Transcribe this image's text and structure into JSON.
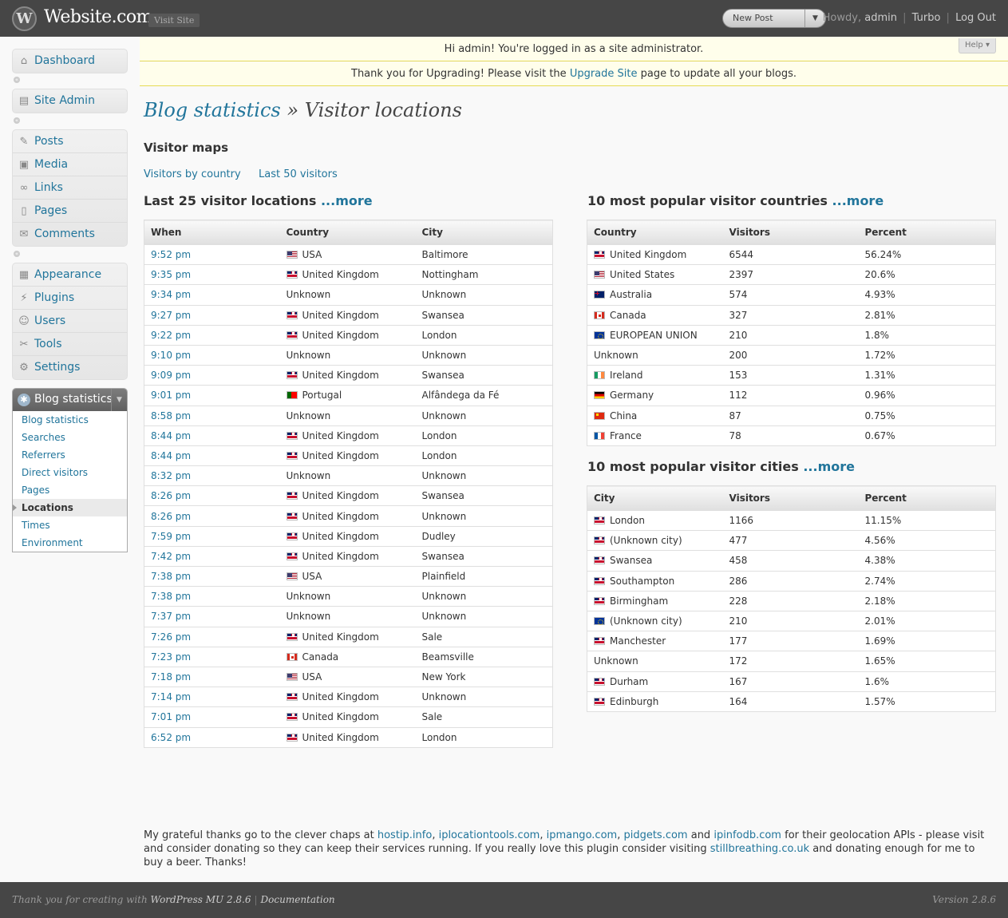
{
  "header": {
    "logo": "W",
    "site_title": "Website.com",
    "visit_site": "Visit Site",
    "new_post": "New Post",
    "howdy": "Howdy,",
    "user": "admin",
    "turbo": "Turbo",
    "logout": "Log Out"
  },
  "notices": {
    "admin_notice": "Hi admin! You're logged in as a site administrator.",
    "help": "Help",
    "upgrade_prefix": "Thank you for Upgrading! Please visit the ",
    "upgrade_link": "Upgrade Site",
    "upgrade_suffix": " page to update all your blogs."
  },
  "sidebar": {
    "dashboard": "Dashboard",
    "site_admin": "Site Admin",
    "group1": [
      "Posts",
      "Media",
      "Links",
      "Pages",
      "Comments"
    ],
    "group2": [
      "Appearance",
      "Plugins",
      "Users",
      "Tools",
      "Settings"
    ],
    "stats_head": "Blog statistics",
    "stats_sub": [
      "Blog statistics",
      "Searches",
      "Referrers",
      "Direct visitors",
      "Pages",
      "Locations",
      "Times",
      "Environment"
    ],
    "current_sub": "Locations"
  },
  "main": {
    "title_link": "Blog statistics",
    "title_sep": " » ",
    "title_rest": "Visitor locations",
    "visitor_maps": "Visitor maps",
    "link_country": "Visitors by country",
    "link_last50": "Last 50 visitors",
    "more": "...more",
    "last25_title": "Last 25 visitor locations ",
    "countries_title": "10 most popular visitor countries ",
    "cities_title": "10 most popular visitor cities "
  },
  "last25": {
    "headers": [
      "When",
      "Country",
      "City"
    ],
    "rows": [
      [
        "9:52 pm",
        "us",
        "USA",
        "Baltimore"
      ],
      [
        "9:35 pm",
        "uk",
        "United Kingdom",
        "Nottingham"
      ],
      [
        "9:34 pm",
        "",
        "Unknown",
        "Unknown"
      ],
      [
        "9:27 pm",
        "uk",
        "United Kingdom",
        "Swansea"
      ],
      [
        "9:22 pm",
        "uk",
        "United Kingdom",
        "London"
      ],
      [
        "9:10 pm",
        "",
        "Unknown",
        "Unknown"
      ],
      [
        "9:09 pm",
        "uk",
        "United Kingdom",
        "Swansea"
      ],
      [
        "9:01 pm",
        "pt",
        "Portugal",
        "Alfândega da Fé"
      ],
      [
        "8:58 pm",
        "",
        "Unknown",
        "Unknown"
      ],
      [
        "8:44 pm",
        "uk",
        "United Kingdom",
        "London"
      ],
      [
        "8:44 pm",
        "uk",
        "United Kingdom",
        "London"
      ],
      [
        "8:32 pm",
        "",
        "Unknown",
        "Unknown"
      ],
      [
        "8:26 pm",
        "uk",
        "United Kingdom",
        "Swansea"
      ],
      [
        "8:26 pm",
        "uk",
        "United Kingdom",
        "Unknown"
      ],
      [
        "7:59 pm",
        "uk",
        "United Kingdom",
        "Dudley"
      ],
      [
        "7:42 pm",
        "uk",
        "United Kingdom",
        "Swansea"
      ],
      [
        "7:38 pm",
        "us",
        "USA",
        "Plainfield"
      ],
      [
        "7:38 pm",
        "",
        "Unknown",
        "Unknown"
      ],
      [
        "7:37 pm",
        "",
        "Unknown",
        "Unknown"
      ],
      [
        "7:26 pm",
        "uk",
        "United Kingdom",
        "Sale"
      ],
      [
        "7:23 pm",
        "ca",
        "Canada",
        "Beamsville"
      ],
      [
        "7:18 pm",
        "us",
        "USA",
        "New York"
      ],
      [
        "7:14 pm",
        "uk",
        "United Kingdom",
        "Unknown"
      ],
      [
        "7:01 pm",
        "uk",
        "United Kingdom",
        "Sale"
      ],
      [
        "6:52 pm",
        "uk",
        "United Kingdom",
        "London"
      ]
    ]
  },
  "countries": {
    "headers": [
      "Country",
      "Visitors",
      "Percent"
    ],
    "rows": [
      [
        "uk",
        "United Kingdom",
        "6544",
        "56.24%"
      ],
      [
        "us",
        "United States",
        "2397",
        "20.6%"
      ],
      [
        "au",
        "Australia",
        "574",
        "4.93%"
      ],
      [
        "ca",
        "Canada",
        "327",
        "2.81%"
      ],
      [
        "eu",
        "EUROPEAN UNION",
        "210",
        "1.8%"
      ],
      [
        "",
        "Unknown",
        "200",
        "1.72%"
      ],
      [
        "ie",
        "Ireland",
        "153",
        "1.31%"
      ],
      [
        "de",
        "Germany",
        "112",
        "0.96%"
      ],
      [
        "cn",
        "China",
        "87",
        "0.75%"
      ],
      [
        "fr",
        "France",
        "78",
        "0.67%"
      ]
    ]
  },
  "cities": {
    "headers": [
      "City",
      "Visitors",
      "Percent"
    ],
    "rows": [
      [
        "uk",
        "London",
        "1166",
        "11.15%"
      ],
      [
        "uk",
        "(Unknown city)",
        "477",
        "4.56%"
      ],
      [
        "uk",
        "Swansea",
        "458",
        "4.38%"
      ],
      [
        "uk",
        "Southampton",
        "286",
        "2.74%"
      ],
      [
        "uk",
        "Birmingham",
        "228",
        "2.18%"
      ],
      [
        "eu",
        "(Unknown city)",
        "210",
        "2.01%"
      ],
      [
        "uk",
        "Manchester",
        "177",
        "1.69%"
      ],
      [
        "",
        "Unknown",
        "172",
        "1.65%"
      ],
      [
        "uk",
        "Durham",
        "167",
        "1.6%"
      ],
      [
        "uk",
        "Edinburgh",
        "164",
        "1.57%"
      ]
    ]
  },
  "thanks": {
    "p1": "My grateful thanks go to the clever chaps at ",
    "l1": "hostip.info",
    "s1": ", ",
    "l2": "iplocationtools.com",
    "s2": ", ",
    "l3": "ipmango.com",
    "s3": ", ",
    "l4": "pidgets.com",
    "s4": " and ",
    "l5": "ipinfodb.com",
    "p2": " for their geolocation APIs - please visit and consider donating so they can keep their services running. If you really love this plugin consider visiting ",
    "l6": "stillbreathing.co.uk",
    "p3": " and donating enough for me to buy a beer. Thanks!"
  },
  "footer": {
    "thanks": "Thank you for creating with ",
    "wp": "WordPress MU 2.8.6",
    "sep": "|",
    "docs": "Documentation",
    "version": "Version 2.8.6"
  }
}
